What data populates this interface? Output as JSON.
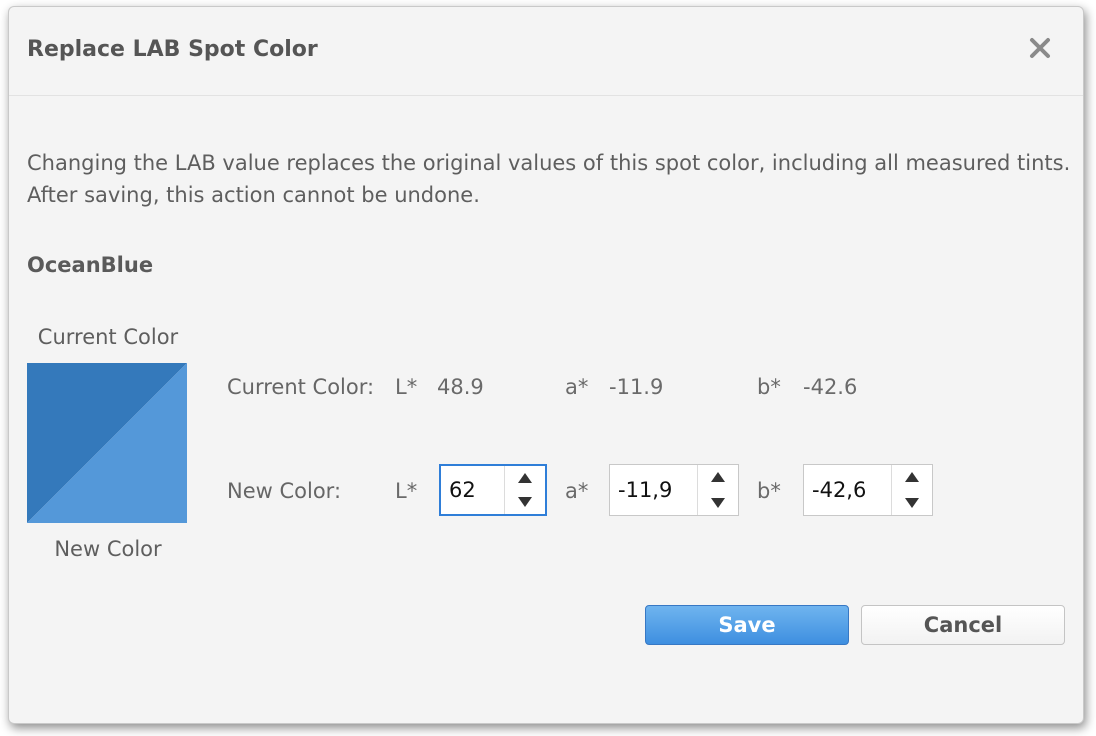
{
  "dialog": {
    "title": "Replace LAB Spot Color",
    "description_line1": "Changing the LAB value replaces the original values of this spot color, including all measured tints.",
    "description_line2": "After saving, this action cannot be undone.",
    "color_name": "OceanBlue"
  },
  "swatch": {
    "current_label": "Current Color",
    "new_label": "New Color",
    "current_color": "#3479bb",
    "new_color": "#5498d9"
  },
  "current_row": {
    "label": "Current Color:",
    "L_label": "L*",
    "L_value": "48.9",
    "a_label": "a*",
    "a_value": "-11.9",
    "b_label": "b*",
    "b_value": "-42.6"
  },
  "new_row": {
    "label": "New Color:",
    "L_label": "L*",
    "L_value": "62",
    "a_label": "a*",
    "a_value": "-11,9",
    "b_label": "b*",
    "b_value": "-42,6"
  },
  "buttons": {
    "save": "Save",
    "cancel": "Cancel"
  },
  "icons": {
    "close": "close-icon",
    "up": "arrow-up-icon",
    "down": "arrow-down-icon"
  },
  "colors": {
    "accent": "#2f7ed8",
    "save_button": "#4a99e6"
  }
}
